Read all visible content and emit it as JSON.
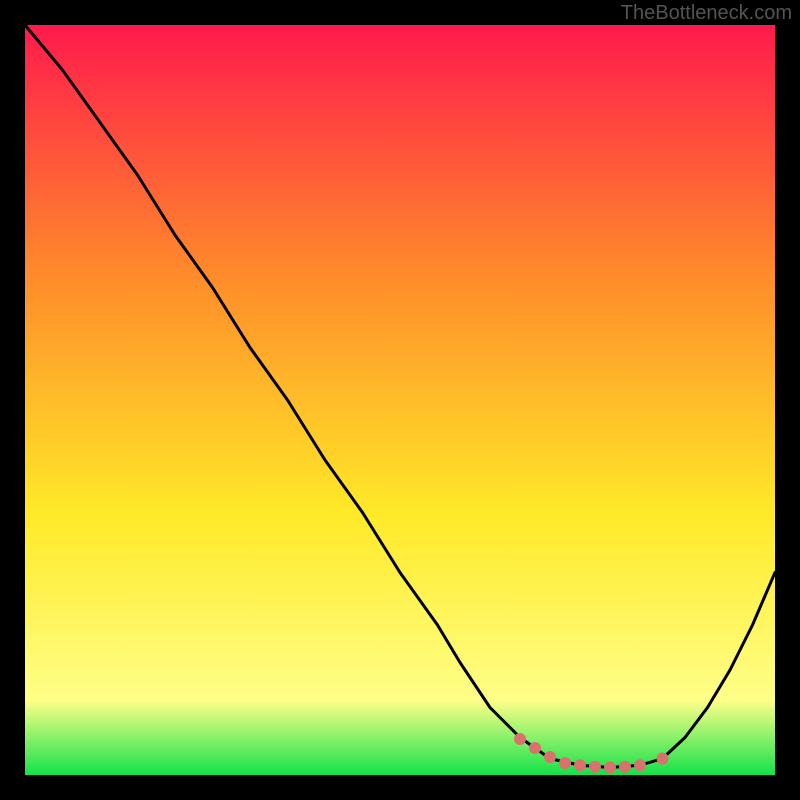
{
  "watermark": "TheBottleneck.com",
  "chart_data": {
    "type": "line",
    "title": "",
    "xlabel": "",
    "ylabel": "",
    "xlim": [
      0,
      100
    ],
    "ylim": [
      0,
      100
    ],
    "gradient_colors": {
      "top": "#ff1a4c",
      "mid_upper": "#ff8a2b",
      "mid": "#ffe927",
      "lower_band": "#ffff88",
      "bottom": "#13e24a"
    },
    "curve": {
      "name": "bottleneck-curve",
      "color": "#000000",
      "x": [
        0,
        5,
        10,
        15,
        20,
        25,
        30,
        35,
        40,
        45,
        50,
        55,
        58,
        62,
        66,
        70,
        74,
        78,
        82,
        85,
        88,
        91,
        94,
        97,
        100
      ],
      "y": [
        100,
        94,
        87,
        80,
        72,
        65,
        57,
        50,
        42,
        35,
        27,
        20,
        15,
        9,
        5,
        2.2,
        1.3,
        1.0,
        1.3,
        2.2,
        5,
        9,
        14,
        20,
        27
      ]
    },
    "markers": {
      "name": "highlight-dots",
      "color": "#d9716d",
      "approx_radius_px": 6,
      "x": [
        66,
        68,
        70,
        72,
        74,
        76,
        78,
        80,
        82,
        85
      ],
      "y": [
        4.8,
        3.6,
        2.4,
        1.6,
        1.3,
        1.1,
        1.0,
        1.1,
        1.3,
        2.2
      ]
    }
  }
}
